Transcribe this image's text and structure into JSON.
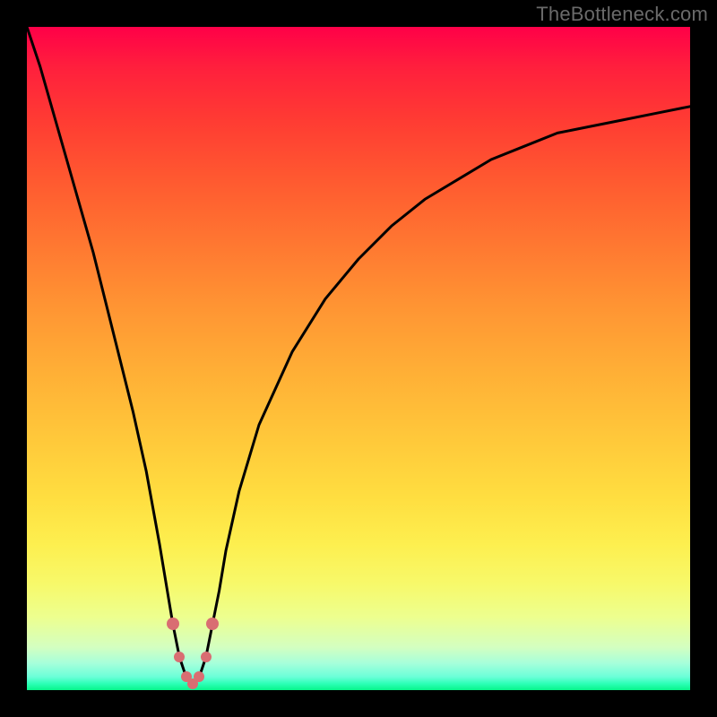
{
  "attribution": "TheBottleneck.com",
  "chart_data": {
    "type": "line",
    "title": "",
    "xlabel": "",
    "ylabel": "",
    "xlim": [
      0,
      100
    ],
    "ylim": [
      0,
      100
    ],
    "series": [
      {
        "name": "bottleneck-curve",
        "x": [
          0,
          2,
          4,
          6,
          8,
          10,
          12,
          14,
          16,
          18,
          20,
          21,
          22,
          23,
          24,
          25,
          26,
          27,
          28,
          29,
          30,
          32,
          35,
          40,
          45,
          50,
          55,
          60,
          65,
          70,
          75,
          80,
          85,
          90,
          95,
          100
        ],
        "values": [
          100,
          94,
          87,
          80,
          73,
          66,
          58,
          50,
          42,
          33,
          22,
          16,
          10,
          5,
          2,
          1,
          2,
          5,
          10,
          15,
          21,
          30,
          40,
          51,
          59,
          65,
          70,
          74,
          77,
          80,
          82,
          84,
          85,
          86,
          87,
          88
        ]
      }
    ],
    "highlighted_region": {
      "x_start": 22,
      "x_end": 28,
      "color": "#d96d72"
    },
    "background_gradient": {
      "top": "#ff0048",
      "bottom": "#07f58a"
    },
    "grid": false
  }
}
